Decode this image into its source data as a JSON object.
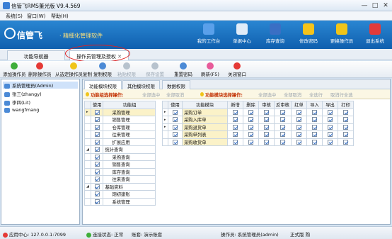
{
  "window": {
    "title": "信管飞RMS董光版 V9.4.569",
    "controls": [
      "—",
      "□",
      "✕"
    ]
  },
  "menu": [
    "系统(S)",
    "窗口(W)",
    "帮助(H)"
  ],
  "banner": {
    "logo": "信管飞",
    "slogan": "· 精细化管理软件",
    "nav": [
      {
        "label": "我的工作台",
        "color": "#5aa0ea"
      },
      {
        "label": "单据中心",
        "color": "#e0ecf8"
      },
      {
        "label": "库存查询",
        "color": "#3a6fc4"
      },
      {
        "label": "修改密码",
        "color": "#f6c31a"
      },
      {
        "label": "更换操作员",
        "color": "#f0c419"
      },
      {
        "label": "退出系统",
        "color": "#e23b3b"
      }
    ]
  },
  "main_tabs": [
    "功能导航器",
    "操作员管理及授权"
  ],
  "toolbar": [
    {
      "label": "添加操作员",
      "color": "#3fae3a",
      "enabled": true
    },
    {
      "label": "删除操作员",
      "color": "#e53935",
      "enabled": true
    },
    {
      "label": "从选定操作员复制",
      "color": "#f0c419",
      "enabled": true
    },
    {
      "label": "复制权限",
      "color": "#4b8ad6",
      "enabled": true
    },
    {
      "label": "粘贴权限",
      "color": "#b7c2cd",
      "enabled": false
    },
    {
      "label": "保存设置",
      "color": "#b7c2cd",
      "enabled": false
    },
    {
      "label": "重置密码",
      "color": "#4b8ad6",
      "enabled": true
    },
    {
      "label": "刷新(F5)",
      "color": "#e85b9a",
      "enabled": true
    },
    {
      "label": "关闭窗口",
      "color": "#e53935",
      "enabled": true
    }
  ],
  "operators": [
    "系统管理员(Admin)",
    "张三(zhangy)",
    "李四(Lit)",
    "wangfmang"
  ],
  "subtabs": [
    "功能模块权限",
    "其他模块权限",
    "数据权限"
  ],
  "left_actions": {
    "title": "功能组选择操作:",
    "items": [
      "全部选中",
      "全部取消"
    ]
  },
  "right_actions": {
    "title": "功能模块选择操作:",
    "items": [
      "全部选中",
      "全部取消",
      "全选行",
      "取消行全选"
    ]
  },
  "groups": {
    "headers": [
      "使用",
      "功能组"
    ],
    "rows": [
      {
        "name": "采购管理",
        "level": 1,
        "checked": true,
        "sel": true,
        "mark": "▸"
      },
      {
        "name": "销售管理",
        "level": 1,
        "checked": true
      },
      {
        "name": "仓库管理",
        "level": 1,
        "checked": true
      },
      {
        "name": "往来管理",
        "level": 1,
        "checked": true
      },
      {
        "name": "扩展应用",
        "level": 1,
        "checked": true
      },
      {
        "name": "统计查询",
        "level": 0,
        "checked": true,
        "mark": "◢"
      },
      {
        "name": "采购查询",
        "level": 1,
        "checked": true
      },
      {
        "name": "销售查询",
        "level": 1,
        "checked": true
      },
      {
        "name": "库存查询",
        "level": 1,
        "checked": true
      },
      {
        "name": "往来查询",
        "level": 1,
        "checked": true
      },
      {
        "name": "基础资料",
        "level": 0,
        "checked": true,
        "mark": "◢"
      },
      {
        "name": "期初建账",
        "level": 1,
        "checked": true
      },
      {
        "name": "系统管理",
        "level": 1,
        "checked": true
      }
    ]
  },
  "modules": {
    "headers": [
      "使用",
      "功能模块",
      "新增",
      "删除",
      "审核",
      "反审核",
      "红单",
      "导入",
      "导出",
      "打印"
    ],
    "rows": [
      {
        "name": "采购订单",
        "sel": true,
        "mark": "▸",
        "vals": [
          true,
          true,
          true,
          true,
          true,
          true,
          true,
          true,
          true
        ]
      },
      {
        "name": "采购入库单",
        "mark": "▸",
        "vals": [
          true,
          true,
          true,
          true,
          true,
          true,
          true,
          true,
          true
        ]
      },
      {
        "name": "采购退货单",
        "mark": "▸",
        "vals": [
          true,
          true,
          true,
          true,
          true,
          true,
          true,
          true,
          true
        ]
      },
      {
        "name": "采购单列表",
        "mark": "",
        "vals": [
          true,
          true,
          true,
          true,
          true,
          true,
          true,
          true,
          true
        ]
      },
      {
        "name": "采购收货单",
        "mark": "",
        "vals": [
          true,
          true,
          true,
          true,
          true,
          true,
          true,
          true,
          true
        ]
      }
    ]
  },
  "status": {
    "app_center": "应用中心: 127.0.0.1:7099",
    "conn": "连接状态: 正常",
    "account": "账套: 演示账套",
    "operator": "操作员: 系统管理员(admin)",
    "edition": "正式版 购"
  }
}
